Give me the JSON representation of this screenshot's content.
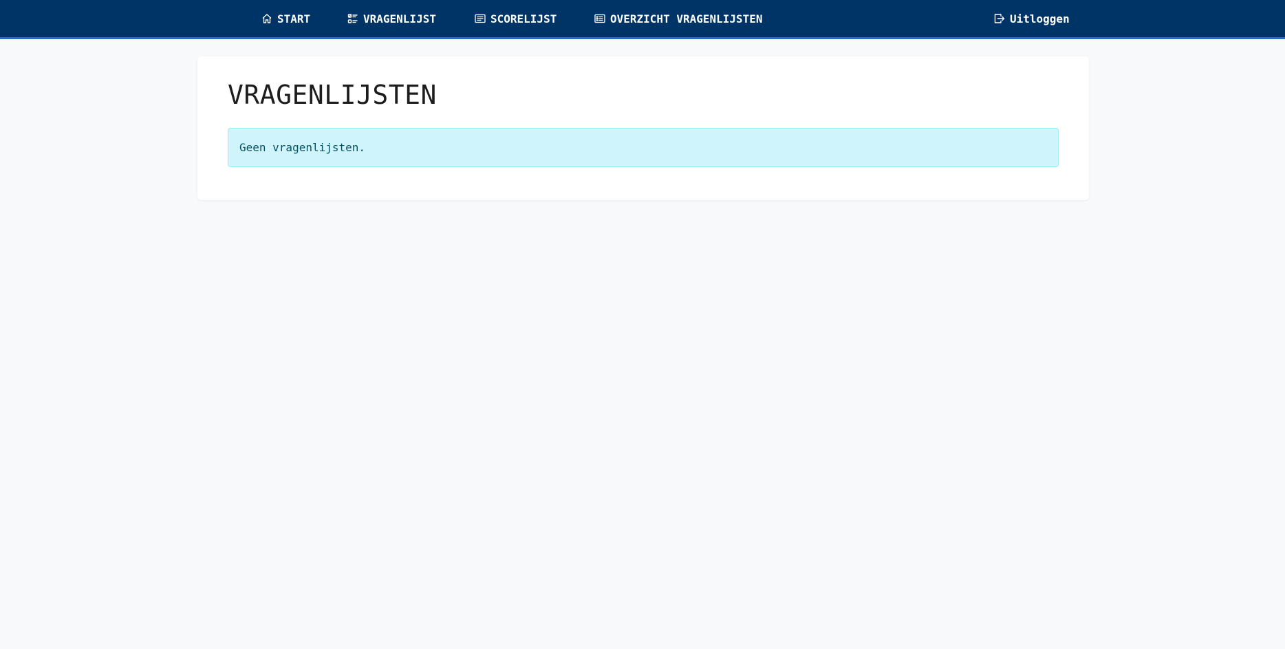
{
  "nav": {
    "items": [
      {
        "label": "START",
        "icon": "home-icon"
      },
      {
        "label": "VRAGENLIJST",
        "icon": "list-check-icon"
      },
      {
        "label": "SCORELIJST",
        "icon": "card-text-icon"
      },
      {
        "label": "OVERZICHT VRAGENLIJSTEN",
        "icon": "card-list-icon"
      }
    ],
    "logout": {
      "label": "Uitloggen",
      "icon": "logout-icon"
    }
  },
  "main": {
    "title": "VRAGENLIJSTEN",
    "alert": "Geen vragenlijsten."
  },
  "colors": {
    "navbar_bg": "#003366",
    "navbar_border": "#2f64c4",
    "page_bg": "#f7f9fb",
    "alert_bg": "#cff4fc",
    "alert_border": "#9eeaf9",
    "alert_text": "#055160"
  }
}
